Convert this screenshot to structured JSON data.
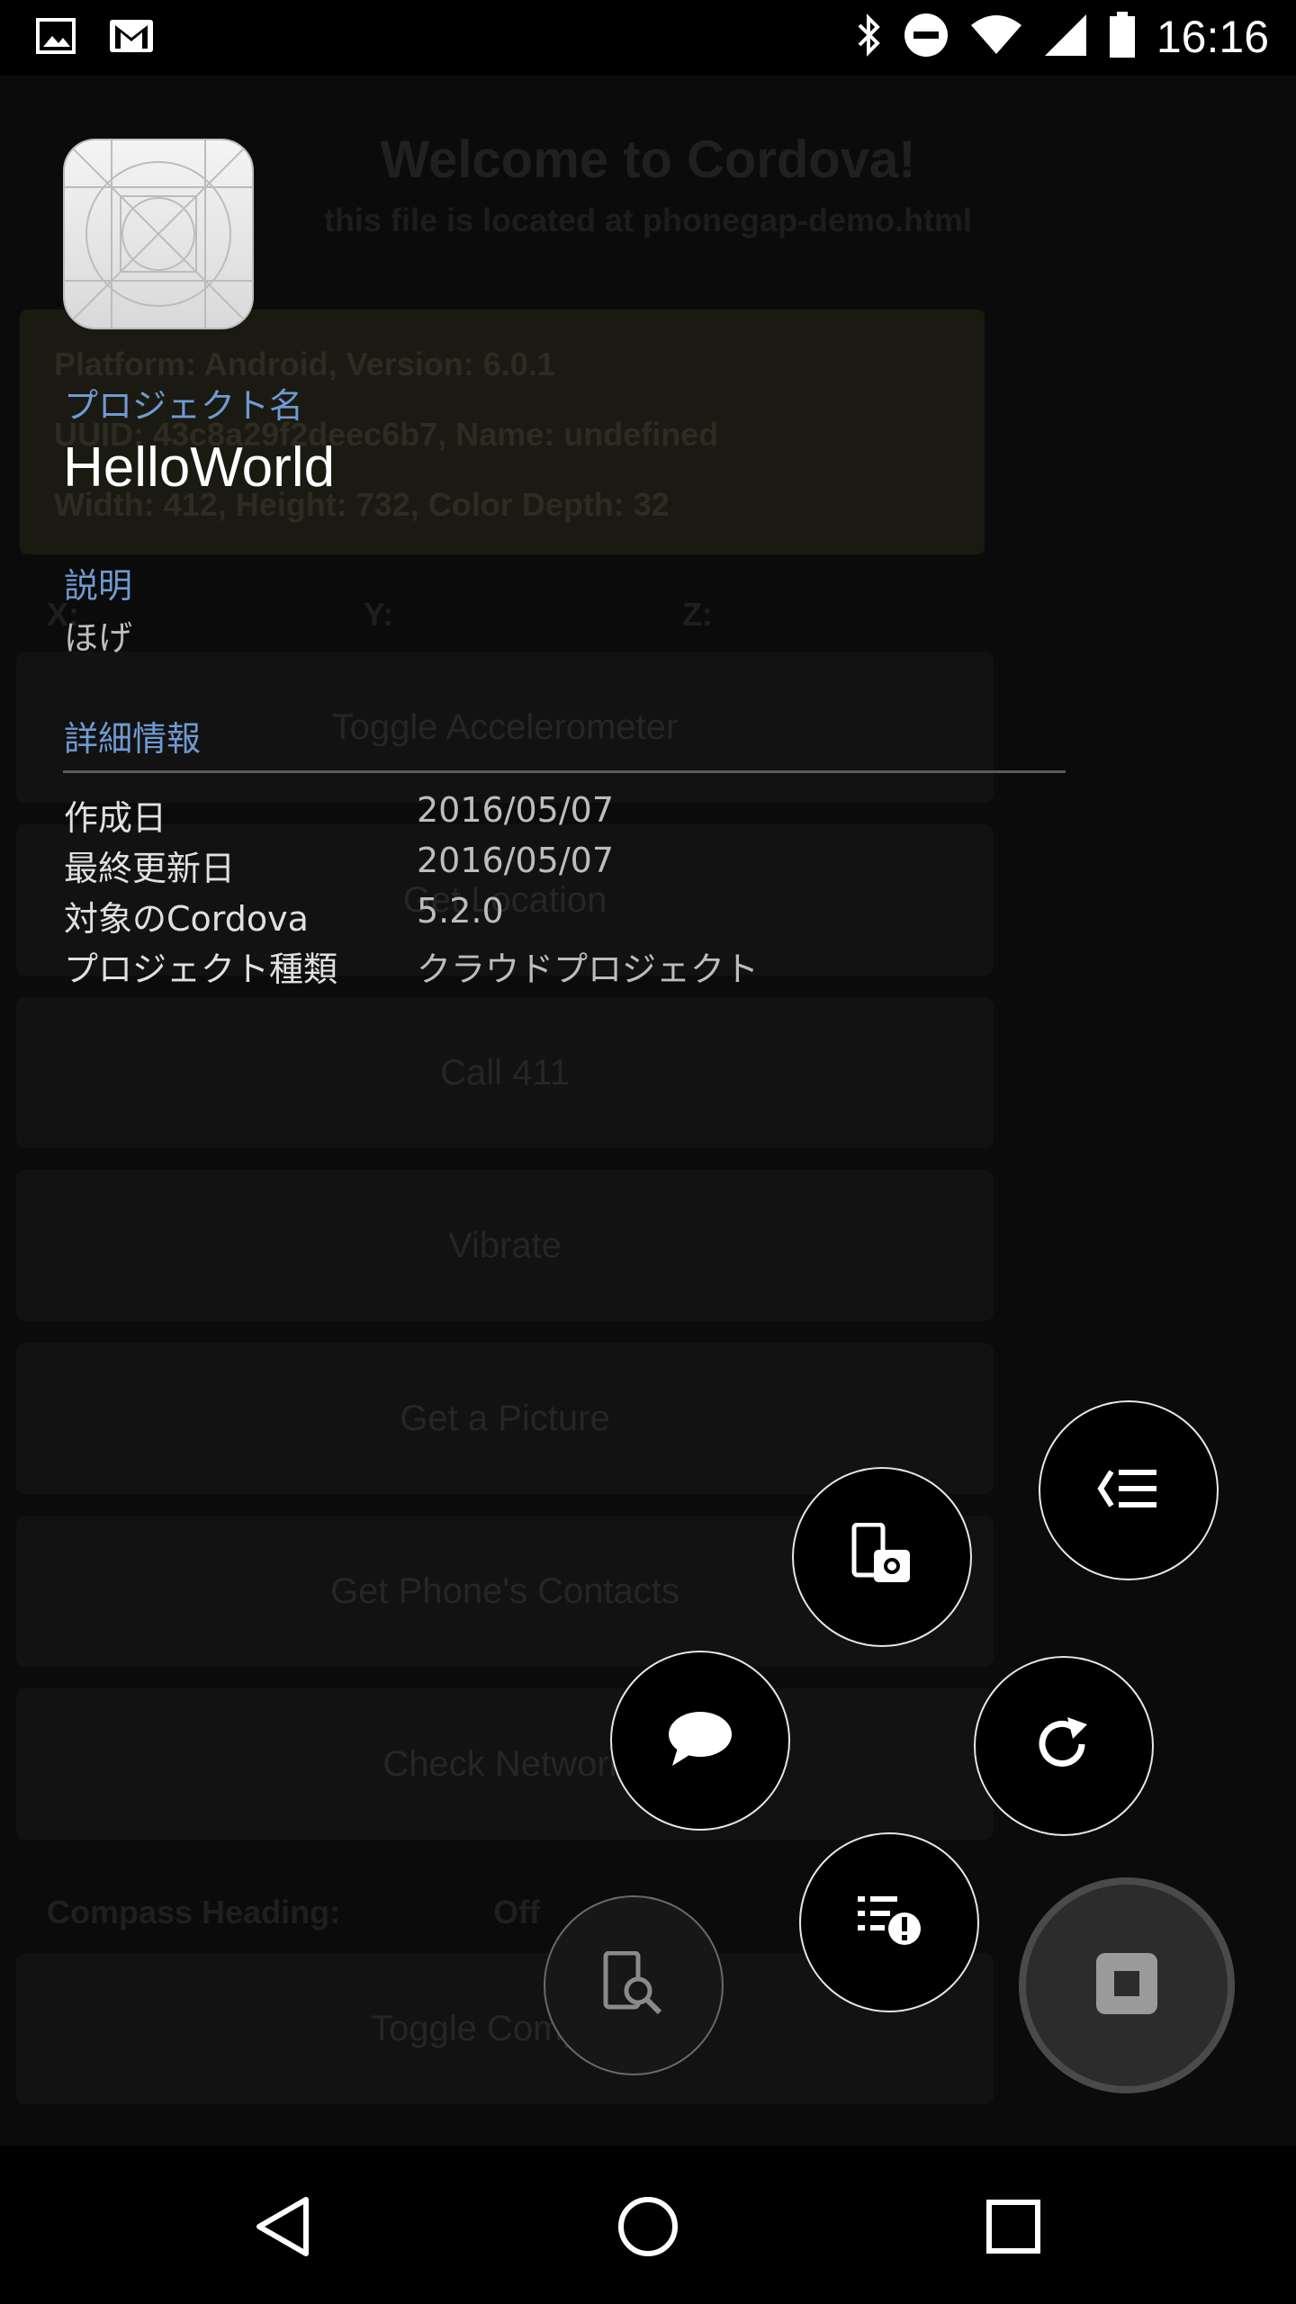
{
  "status_bar": {
    "time": "16:16",
    "left_icons": [
      "image-notification-icon",
      "gmail-icon"
    ],
    "right_icons": [
      "bluetooth-icon",
      "do-not-disturb-icon",
      "wifi-icon",
      "cell-signal-icon",
      "battery-icon"
    ]
  },
  "background_app": {
    "title": "Welcome to Cordova!",
    "subtitle": "this file is located at phonegap-demo.html",
    "info_lines": [
      "Platform: Android, Version: 6.0.1",
      "UUID: 43c8a29f2deec6b7, Name: undefined",
      "Width: 412, Height: 732, Color Depth: 32"
    ],
    "axes": [
      "X:",
      "Y:",
      "Z:"
    ],
    "buttons": [
      "Toggle Accelerometer",
      "Get Location",
      "Call 411",
      "Vibrate",
      "Get a Picture",
      "Get Phone's Contacts",
      "Check Network",
      "Toggle Compass"
    ],
    "compass_label": "Compass Heading:",
    "compass_value": "Off"
  },
  "project_panel": {
    "name_label": "プロジェクト名",
    "name": "HelloWorld",
    "description_label": "説明",
    "description": "ほげ",
    "details_label": "詳細情報",
    "details": [
      {
        "key": "作成日",
        "value": "2016/05/07"
      },
      {
        "key": "最終更新日",
        "value": "2016/05/07"
      },
      {
        "key": "対象のCordova",
        "value": "5.2.0"
      },
      {
        "key": "プロジェクト種類",
        "value": "クラウドプロジェクト"
      }
    ]
  },
  "fab_menu": {
    "buttons": [
      "collapse-menu-icon",
      "screenshot-icon",
      "comment-icon",
      "reload-icon",
      "error-log-icon",
      "inspect-icon"
    ],
    "main": "stop-icon"
  },
  "nav_bar": {
    "buttons": [
      "back-icon",
      "home-icon",
      "recents-icon"
    ]
  }
}
